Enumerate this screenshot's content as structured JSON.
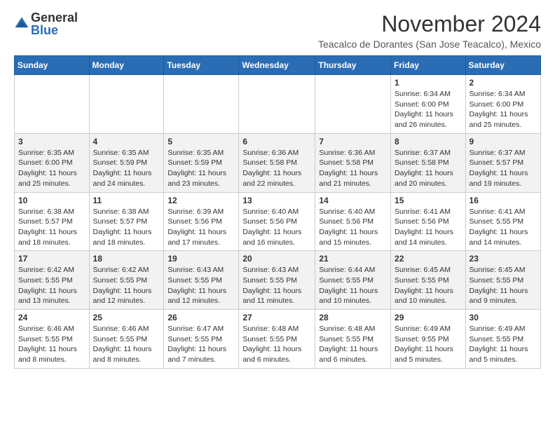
{
  "header": {
    "logo": {
      "general": "General",
      "blue": "Blue"
    },
    "title": "November 2024",
    "subtitle": "Teacalco de Dorantes (San Jose Teacalco), Mexico"
  },
  "days_of_week": [
    "Sunday",
    "Monday",
    "Tuesday",
    "Wednesday",
    "Thursday",
    "Friday",
    "Saturday"
  ],
  "weeks": [
    [
      {
        "day": "",
        "info": ""
      },
      {
        "day": "",
        "info": ""
      },
      {
        "day": "",
        "info": ""
      },
      {
        "day": "",
        "info": ""
      },
      {
        "day": "",
        "info": ""
      },
      {
        "day": "1",
        "info": "Sunrise: 6:34 AM\nSunset: 6:00 PM\nDaylight: 11 hours\nand 26 minutes."
      },
      {
        "day": "2",
        "info": "Sunrise: 6:34 AM\nSunset: 6:00 PM\nDaylight: 11 hours\nand 25 minutes."
      }
    ],
    [
      {
        "day": "3",
        "info": "Sunrise: 6:35 AM\nSunset: 6:00 PM\nDaylight: 11 hours\nand 25 minutes."
      },
      {
        "day": "4",
        "info": "Sunrise: 6:35 AM\nSunset: 5:59 PM\nDaylight: 11 hours\nand 24 minutes."
      },
      {
        "day": "5",
        "info": "Sunrise: 6:35 AM\nSunset: 5:59 PM\nDaylight: 11 hours\nand 23 minutes."
      },
      {
        "day": "6",
        "info": "Sunrise: 6:36 AM\nSunset: 5:58 PM\nDaylight: 11 hours\nand 22 minutes."
      },
      {
        "day": "7",
        "info": "Sunrise: 6:36 AM\nSunset: 5:58 PM\nDaylight: 11 hours\nand 21 minutes."
      },
      {
        "day": "8",
        "info": "Sunrise: 6:37 AM\nSunset: 5:58 PM\nDaylight: 11 hours\nand 20 minutes."
      },
      {
        "day": "9",
        "info": "Sunrise: 6:37 AM\nSunset: 5:57 PM\nDaylight: 11 hours\nand 19 minutes."
      }
    ],
    [
      {
        "day": "10",
        "info": "Sunrise: 6:38 AM\nSunset: 5:57 PM\nDaylight: 11 hours\nand 18 minutes."
      },
      {
        "day": "11",
        "info": "Sunrise: 6:38 AM\nSunset: 5:57 PM\nDaylight: 11 hours\nand 18 minutes."
      },
      {
        "day": "12",
        "info": "Sunrise: 6:39 AM\nSunset: 5:56 PM\nDaylight: 11 hours\nand 17 minutes."
      },
      {
        "day": "13",
        "info": "Sunrise: 6:40 AM\nSunset: 5:56 PM\nDaylight: 11 hours\nand 16 minutes."
      },
      {
        "day": "14",
        "info": "Sunrise: 6:40 AM\nSunset: 5:56 PM\nDaylight: 11 hours\nand 15 minutes."
      },
      {
        "day": "15",
        "info": "Sunrise: 6:41 AM\nSunset: 5:56 PM\nDaylight: 11 hours\nand 14 minutes."
      },
      {
        "day": "16",
        "info": "Sunrise: 6:41 AM\nSunset: 5:55 PM\nDaylight: 11 hours\nand 14 minutes."
      }
    ],
    [
      {
        "day": "17",
        "info": "Sunrise: 6:42 AM\nSunset: 5:55 PM\nDaylight: 11 hours\nand 13 minutes."
      },
      {
        "day": "18",
        "info": "Sunrise: 6:42 AM\nSunset: 5:55 PM\nDaylight: 11 hours\nand 12 minutes."
      },
      {
        "day": "19",
        "info": "Sunrise: 6:43 AM\nSunset: 5:55 PM\nDaylight: 11 hours\nand 12 minutes."
      },
      {
        "day": "20",
        "info": "Sunrise: 6:43 AM\nSunset: 5:55 PM\nDaylight: 11 hours\nand 11 minutes."
      },
      {
        "day": "21",
        "info": "Sunrise: 6:44 AM\nSunset: 5:55 PM\nDaylight: 11 hours\nand 10 minutes."
      },
      {
        "day": "22",
        "info": "Sunrise: 6:45 AM\nSunset: 5:55 PM\nDaylight: 11 hours\nand 10 minutes."
      },
      {
        "day": "23",
        "info": "Sunrise: 6:45 AM\nSunset: 5:55 PM\nDaylight: 11 hours\nand 9 minutes."
      }
    ],
    [
      {
        "day": "24",
        "info": "Sunrise: 6:46 AM\nSunset: 5:55 PM\nDaylight: 11 hours\nand 8 minutes."
      },
      {
        "day": "25",
        "info": "Sunrise: 6:46 AM\nSunset: 5:55 PM\nDaylight: 11 hours\nand 8 minutes."
      },
      {
        "day": "26",
        "info": "Sunrise: 6:47 AM\nSunset: 5:55 PM\nDaylight: 11 hours\nand 7 minutes."
      },
      {
        "day": "27",
        "info": "Sunrise: 6:48 AM\nSunset: 5:55 PM\nDaylight: 11 hours\nand 6 minutes."
      },
      {
        "day": "28",
        "info": "Sunrise: 6:48 AM\nSunset: 5:55 PM\nDaylight: 11 hours\nand 6 minutes."
      },
      {
        "day": "29",
        "info": "Sunrise: 6:49 AM\nSunset: 9:55 PM\nDaylight: 11 hours\nand 5 minutes."
      },
      {
        "day": "30",
        "info": "Sunrise: 6:49 AM\nSunset: 5:55 PM\nDaylight: 11 hours\nand 5 minutes."
      }
    ]
  ]
}
